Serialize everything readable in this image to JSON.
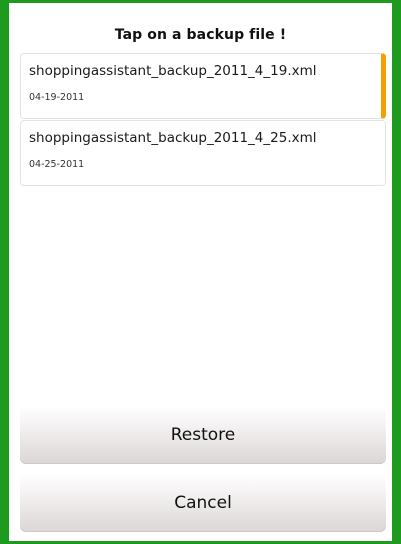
{
  "dialog": {
    "title": "Tap on a backup file !"
  },
  "backups": [
    {
      "filename": "shoppingassistant_backup_2011_4_19.xml",
      "date": "04-19-2011",
      "selected": true
    },
    {
      "filename": "shoppingassistant_backup_2011_4_25.xml",
      "date": "04-25-2011",
      "selected": false
    }
  ],
  "buttons": {
    "restore_label": "Restore",
    "cancel_label": "Cancel"
  },
  "colors": {
    "frame": "#1e9a1e",
    "selection_accent": "#f5a000"
  }
}
